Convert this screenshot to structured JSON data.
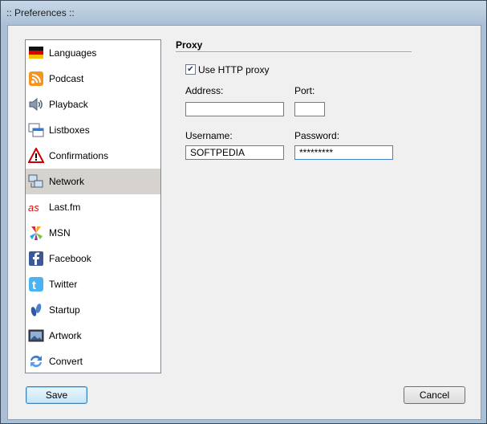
{
  "window": {
    "title": ":: Preferences ::"
  },
  "sidebar": {
    "items": [
      {
        "label": "Languages",
        "icon": "flag-icon"
      },
      {
        "label": "Podcast",
        "icon": "rss-icon"
      },
      {
        "label": "Playback",
        "icon": "speaker-icon"
      },
      {
        "label": "Listboxes",
        "icon": "list-icon"
      },
      {
        "label": "Confirmations",
        "icon": "warning-icon"
      },
      {
        "label": "Network",
        "icon": "network-icon",
        "selected": true
      },
      {
        "label": "Last.fm",
        "icon": "lastfm-icon"
      },
      {
        "label": "MSN",
        "icon": "msn-icon"
      },
      {
        "label": "Facebook",
        "icon": "facebook-icon"
      },
      {
        "label": "Twitter",
        "icon": "twitter-icon"
      },
      {
        "label": "Startup",
        "icon": "startup-icon"
      },
      {
        "label": "Artwork",
        "icon": "artwork-icon"
      },
      {
        "label": "Convert",
        "icon": "convert-icon"
      }
    ]
  },
  "proxy": {
    "section_title": "Proxy",
    "use_http_proxy_label": "Use HTTP proxy",
    "use_http_proxy_checked": true,
    "address_label": "Address:",
    "address_value": "",
    "port_label": "Port:",
    "port_value": "",
    "username_label": "Username:",
    "username_value": "SOFTPEDIA",
    "password_label": "Password:",
    "password_value": "*********"
  },
  "buttons": {
    "save": "Save",
    "cancel": "Cancel"
  },
  "colors": {
    "selection": "#d6d3ce",
    "focus_border": "#3f82c9",
    "frame": "#b4c8dc"
  }
}
